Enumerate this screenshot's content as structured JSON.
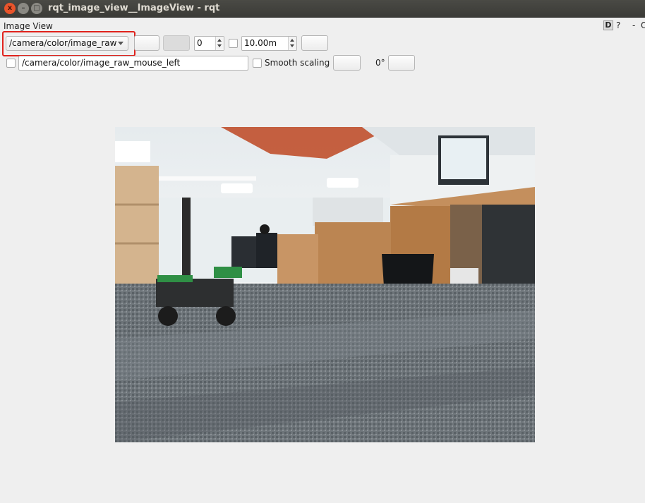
{
  "window": {
    "title": "rqt_image_view__ImageView - rqt",
    "close_glyph": "x",
    "min_glyph": "–",
    "max_glyph": "□"
  },
  "plugin": {
    "title": "Image View",
    "dock_d": "D",
    "dock_help": "?",
    "dock_min": "-",
    "dock_close": "O"
  },
  "toolbar": {
    "topic": "/camera/color/image_raw",
    "spin_value": "0",
    "max_range": "10.00m"
  },
  "row2": {
    "mouse_topic": "/camera/color/image_raw_mouse_left",
    "smooth_label": "Smooth scaling",
    "rotation_label": "0°"
  },
  "image": {
    "scene": "camera-feed",
    "colors": {
      "highlight": "#e0221c",
      "ceiling_accent": "#c0502c"
    }
  }
}
